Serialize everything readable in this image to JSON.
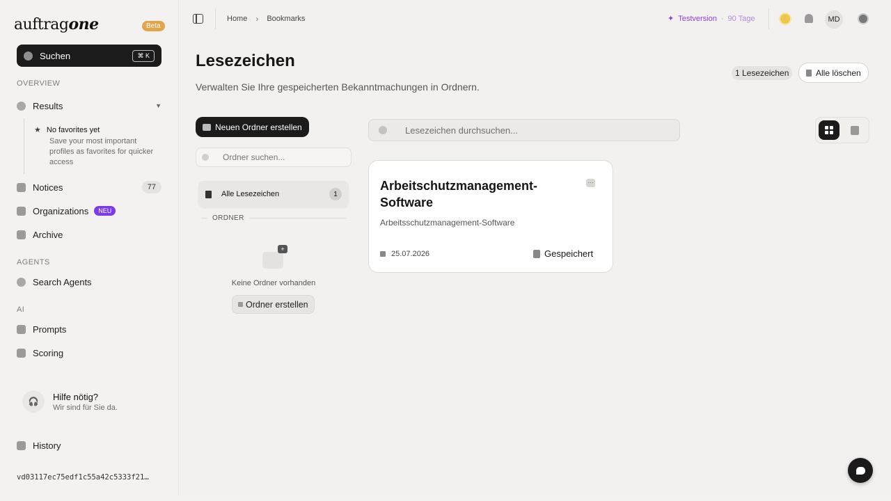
{
  "brand": {
    "name_light": "auftrag",
    "name_bold": "one",
    "beta": "Beta"
  },
  "search": {
    "label": "Suchen",
    "shortcut": "⌘ K"
  },
  "sidebar": {
    "overview_label": "OVERVIEW",
    "results": "Results",
    "favorites": {
      "title": "No favorites yet",
      "desc": "Save your most important profiles as favorites for quicker access"
    },
    "notices": {
      "label": "Notices",
      "count": "77"
    },
    "organizations": {
      "label": "Organizations",
      "badge": "NEU"
    },
    "archive": "Archive",
    "agents_label": "AGENTS",
    "search_agents": "Search Agents",
    "ai_label": "AI",
    "prompts": "Prompts",
    "scoring": "Scoring",
    "help": {
      "title": "Hilfe nötig?",
      "subtitle": "Wir sind für Sie da."
    },
    "history": "History",
    "version_hash": "vd03117ec75edf1c55a42c5333f21…"
  },
  "topbar": {
    "breadcrumb": {
      "home": "Home",
      "current": "Bookmarks"
    },
    "trial": {
      "label": "Testversion",
      "days": "90 Tage"
    },
    "avatar_initials": "MD"
  },
  "page": {
    "title": "Lesezeichen",
    "subtitle": "Verwalten Sie Ihre gespeicherten Bekanntmachungen in Ordnern.",
    "bookmark_count": "1 Lesezeichen",
    "clear_all": "Alle löschen"
  },
  "folders": {
    "new_folder": "Neuen Ordner erstellen",
    "search_placeholder": "Ordner suchen...",
    "all_bookmarks": {
      "label": "Alle Lesezeichen",
      "count": "1"
    },
    "section_label": "ORDNER",
    "empty_text": "Keine Ordner vorhanden",
    "create_button": "Ordner erstellen"
  },
  "bookmarks": {
    "search_placeholder": "Lesezeichen durchsuchen...",
    "items": [
      {
        "title": "Arbeitschutzmanagement-Software",
        "description": "Arbeitsschutzmanagement-Software",
        "date": "25.07.2026",
        "status": "Gespeichert"
      }
    ]
  },
  "colors": {
    "accent_dark": "#1b1b1b",
    "trial_purple": "#8b3fd9",
    "beta_orange": "#e2a54a",
    "neu_purple": "#7c3aed"
  },
  "icons": [
    "search-icon",
    "star-icon",
    "file-icon",
    "building-icon",
    "bookmark-icon",
    "agent-icon",
    "chip-icon",
    "scoring-icon",
    "headset-icon",
    "history-icon",
    "sidebar-toggle-icon",
    "chevron-right-icon",
    "sparkle-icon",
    "sun-icon",
    "bell-icon",
    "gear-icon",
    "folder-plus-icon",
    "trash-icon",
    "grid-view-icon",
    "list-view-icon",
    "calendar-icon",
    "more-icon",
    "chat-icon"
  ]
}
